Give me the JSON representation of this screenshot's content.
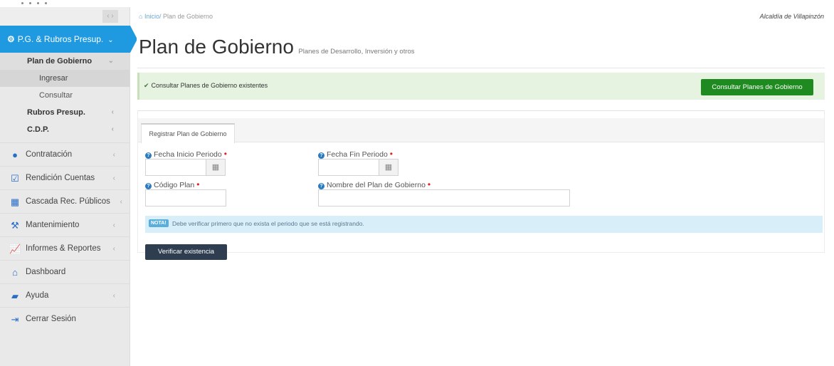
{
  "header": {
    "breadcrumb_home": "Inicio/",
    "breadcrumb_current": "Plan de Gobierno",
    "municipality": "Alcaldía de Villapinzón"
  },
  "page": {
    "title": "Plan de Gobierno",
    "subtitle": "Planes de Desarrollo, Inversión y otros"
  },
  "alert": {
    "message": "Consultar Planes de Gobierno existentes",
    "button_label": "Consultar Planes de Gobierno"
  },
  "sidebar": {
    "section_label": "P.G. & Rubros Presup.",
    "group_label": "Plan de Gobierno",
    "sub_items": [
      "Ingresar",
      "Consultar"
    ],
    "rubros_label": "Rubros Presup.",
    "cdp_label": "C.D.P.",
    "items": [
      {
        "label": "Contratación",
        "icon": "circle-icon"
      },
      {
        "label": "Rendición Cuentas",
        "icon": "check-square-icon"
      },
      {
        "label": "Cascada Rec. Públicos",
        "icon": "grid-icon"
      },
      {
        "label": "Mantenimiento",
        "icon": "wrench-icon"
      },
      {
        "label": "Informes & Reportes",
        "icon": "line-chart-icon"
      },
      {
        "label": "Dashboard",
        "icon": "home-icon"
      },
      {
        "label": "Ayuda",
        "icon": "book-icon"
      },
      {
        "label": "Cerrar Sesión",
        "icon": "sign-out-icon"
      }
    ]
  },
  "form": {
    "tab_label": "Registrar Plan de Gobierno",
    "fecha_inicio_label": "Fecha Inicio Periodo",
    "fecha_fin_label": "Fecha Fin Periodo",
    "codigo_label": "Código Plan",
    "nombre_label": "Nombre del Plan de Gobierno",
    "note_tag": "NOTA!",
    "note_text": "Debe verificar primero que no exista el periodo que se está registrando.",
    "verify_button": "Verificar existencia"
  },
  "colors": {
    "sidebar_active": "#1f9ae0",
    "success_button": "#1f8a1f",
    "dark_button": "#2e3e50",
    "alert_bg": "#e7f3e1",
    "note_bg": "#d8eef8"
  }
}
